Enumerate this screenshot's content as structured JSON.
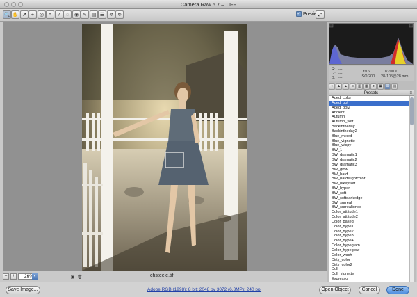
{
  "window": {
    "title": "Camera Raw 5.7  –  TIFF"
  },
  "toolbar": {
    "tools": [
      {
        "name": "zoom-tool-icon",
        "glyph": "🔍"
      },
      {
        "name": "hand-tool-icon",
        "glyph": "✋"
      },
      {
        "name": "white-balance-tool-icon",
        "glyph": "↗"
      },
      {
        "name": "color-sampler-tool-icon",
        "glyph": "⌖"
      },
      {
        "name": "targeted-adjustment-tool-icon",
        "glyph": "◎"
      },
      {
        "name": "crop-tool-icon",
        "glyph": "⌗"
      },
      {
        "name": "straighten-tool-icon",
        "glyph": "╱"
      },
      {
        "name": "spot-removal-tool-icon",
        "glyph": "◌"
      },
      {
        "name": "red-eye-tool-icon",
        "glyph": "◉"
      },
      {
        "name": "adjustment-brush-icon",
        "glyph": "✎"
      },
      {
        "name": "graduated-filter-icon",
        "glyph": "▤"
      },
      {
        "name": "preferences-icon",
        "glyph": "☰"
      },
      {
        "name": "rotate-ccw-icon",
        "glyph": "↺"
      },
      {
        "name": "rotate-cw-icon",
        "glyph": "↻"
      }
    ],
    "preview_label": "Preview",
    "preview_checked": true,
    "fullscreen_glyph": "⤢"
  },
  "image": {
    "filename": "chsteele.tif"
  },
  "zoom": {
    "value": "26%",
    "minus": "–",
    "plus": "+",
    "arrow": "▾"
  },
  "readout": {
    "r_label": "R:",
    "g_label": "G:",
    "b_label": "B:",
    "r_value": "---",
    "g_value": "---",
    "b_value": "---",
    "aperture": "f/16",
    "shutter": "1/200 s",
    "iso": "ISO 200",
    "lens": "28-105@28 mm"
  },
  "panel_tabs": [
    {
      "name": "basic-tab-icon",
      "glyph": "◑"
    },
    {
      "name": "tone-curve-tab-icon",
      "glyph": "▲"
    },
    {
      "name": "detail-tab-icon",
      "glyph": "▴"
    },
    {
      "name": "hsl-tab-icon",
      "glyph": "≡"
    },
    {
      "name": "split-toning-tab-icon",
      "glyph": "▥"
    },
    {
      "name": "lens-corrections-tab-icon",
      "glyph": "▦"
    },
    {
      "name": "effects-tab-icon",
      "glyph": "●"
    },
    {
      "name": "camera-calibration-tab-icon",
      "glyph": "▣"
    },
    {
      "name": "presets-tab-icon",
      "glyph": "☰"
    },
    {
      "name": "snapshots-tab-icon",
      "glyph": "▤"
    }
  ],
  "presets": {
    "header": "Presets",
    "menu_glyph": "≡",
    "selected": "Aged_pol",
    "items": [
      "Aged_color",
      "Aged_pol",
      "Aged_pol2",
      "Ancient",
      "Autumn",
      "Autumn_soft",
      "Backintheday",
      "Backintheday2",
      "Blue_mixed",
      "Blue_vignette",
      "Blue_wispy",
      "BW_1",
      "BW_dramatic1",
      "BW_dramatic2",
      "BW_dramatic3",
      "BW_glow",
      "BW_hard",
      "BW_hardslightcolor",
      "BW_hikeysoft",
      "BW_hyper",
      "BW_soft",
      "BW_softdarkedge",
      "BW_surreal",
      "BW_surrealtoned",
      "Color_attitude1",
      "Color_attitude2",
      "Color_baked",
      "Color_hype1",
      "Color_hype2",
      "Color_hype3",
      "Color_hype4",
      "Color_hypeglam",
      "Color_hypeglow",
      "Color_wash",
      "Dirty_color",
      "Dirty_color2",
      "Doll",
      "Doll_vignette",
      "Expresso",
      "Expresso_darkedge",
      "Expresso_soft",
      "Expresso_softlighter",
      "Green_softly",
      "Infrared_hikey"
    ]
  },
  "bottom": {
    "save_label": "Save Image...",
    "workflow_link": "Adobe RGB (1998); 8 bit; 2048 by 3072 (6.3MP); 240 ppi",
    "open_label": "Open Object",
    "cancel_label": "Cancel",
    "done_label": "Done"
  },
  "colors": {
    "accent": "#3b6fcb",
    "primary_button": "#4f8fe0"
  }
}
